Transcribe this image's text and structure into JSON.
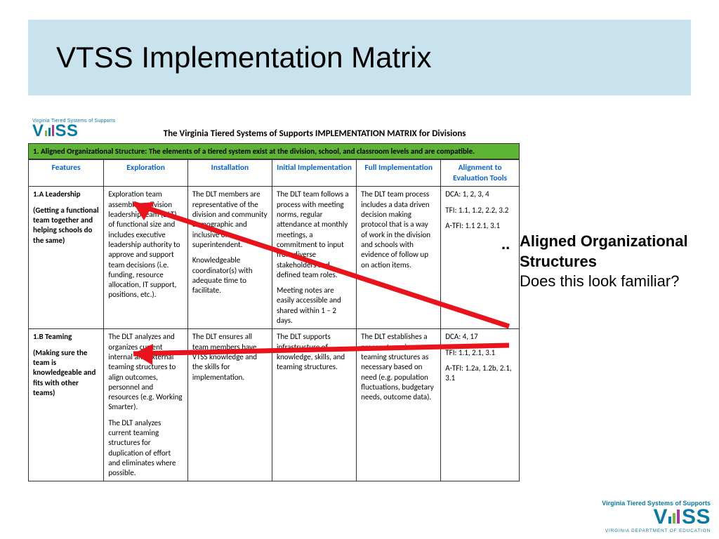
{
  "slide_title": "VTSS Implementation Matrix",
  "logo_tag": "Virginia Tiered Systems of Supports",
  "logo_text": "VTSS",
  "doc_title": "The Virginia Tiered Systems of Supports IMPLEMENTATION MATRIX for Divisions",
  "section_heading": "1. Aligned Organizational Structure:  The elements of a tiered system exist at the division, school, and classroom levels and are compatible.",
  "columns": {
    "features": "Features",
    "exploration": "Exploration",
    "installation": "Installation",
    "initial": "Initial Implementation",
    "full": "Full Implementation",
    "alignment": "Alignment to Evaluation Tools"
  },
  "rows": [
    {
      "feature_code": "1.A Leadership",
      "feature_sub": "(Getting a functional team together and helping schools do the same)",
      "exploration": "Exploration team assembles a division leadership team (DLT) of functional size and includes executive leadership authority to approve and support team decisions (i.e. funding, resource allocation, IT support, positions, etc.).",
      "installation_p1": "The DLT members are representative of the division and community demographic and inclusive of superintendent.",
      "installation_p2": "Knowledgeable coordinator(s) with adequate time to facilitate.",
      "initial_p1": "The DLT team follows a process with meeting norms, regular attendance at monthly meetings, a commitment to input from diverse stakeholders and defined team roles.",
      "initial_p2": "Meeting notes are easily accessible and shared within 1 – 2 days.",
      "full": "The DLT team process includes a data driven decision making protocol that is a way of work in the division and schools with evidence of follow up on action items.",
      "align_l1": "DCA: 1, 2, 3, 4",
      "align_l2": "TFI:  1.1, 1.2, 2.2, 3.2",
      "align_l3": "A-TFI:  1.1 2.1, 3.1"
    },
    {
      "feature_code": "1.B Teaming",
      "feature_sub": "(Making sure the team is knowledgeable and fits with other teams)",
      "exploration_p1": "The DLT analyzes and organizes current internal and external teaming structures to align outcomes, personnel and resources (e.g. Working Smarter).",
      "exploration_p2": "The DLT analyzes current teaming structures for duplication of effort and eliminates where possible.",
      "installation": "The DLT ensures all team members have VTSS knowledge and the skills for implementation.",
      "initial": "The DLT supports infrastructure of knowledge, skills, and teaming structures.",
      "full": "The DLT establishes a process to revise teaming structures as necessary based on need (e.g. population fluctuations, budgetary needs, outcome data).",
      "align_l1": "DCA:  4, 17",
      "align_l2": "TFI:  1.1, 2.1, 3.1",
      "align_l3": "A-TFI:  1.2a, 1.2b, 2.1, 3.1"
    }
  ],
  "callout": {
    "line1": "Aligned Organizational Structures",
    "line2": "Does this look familiar?"
  },
  "footer": {
    "brand_line": "Virginia Tiered Systems of Supports",
    "sub": "VIRGINIA DEPARTMENT OF EDUCATION"
  }
}
